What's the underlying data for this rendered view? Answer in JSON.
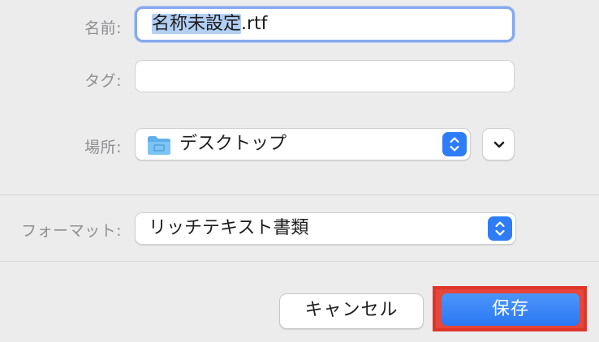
{
  "form": {
    "name_label": "名前:",
    "name_selected": "名称未設定",
    "name_extension": ".rtf",
    "tags_label": "タグ:",
    "tags_value": "",
    "location_label": "場所:",
    "location_value": "デスクトップ",
    "format_label": "フォーマット:",
    "format_value": "リッチテキスト書類"
  },
  "buttons": {
    "cancel": "キャンセル",
    "save": "保存"
  },
  "colors": {
    "accent": "#2f7df6",
    "highlight_frame": "#e0362a",
    "selection": "#b3d0f3"
  },
  "icons": {
    "location": "folder-icon",
    "popup_stepper": "up-down-chevron-icon",
    "expand": "chevron-down-icon"
  }
}
